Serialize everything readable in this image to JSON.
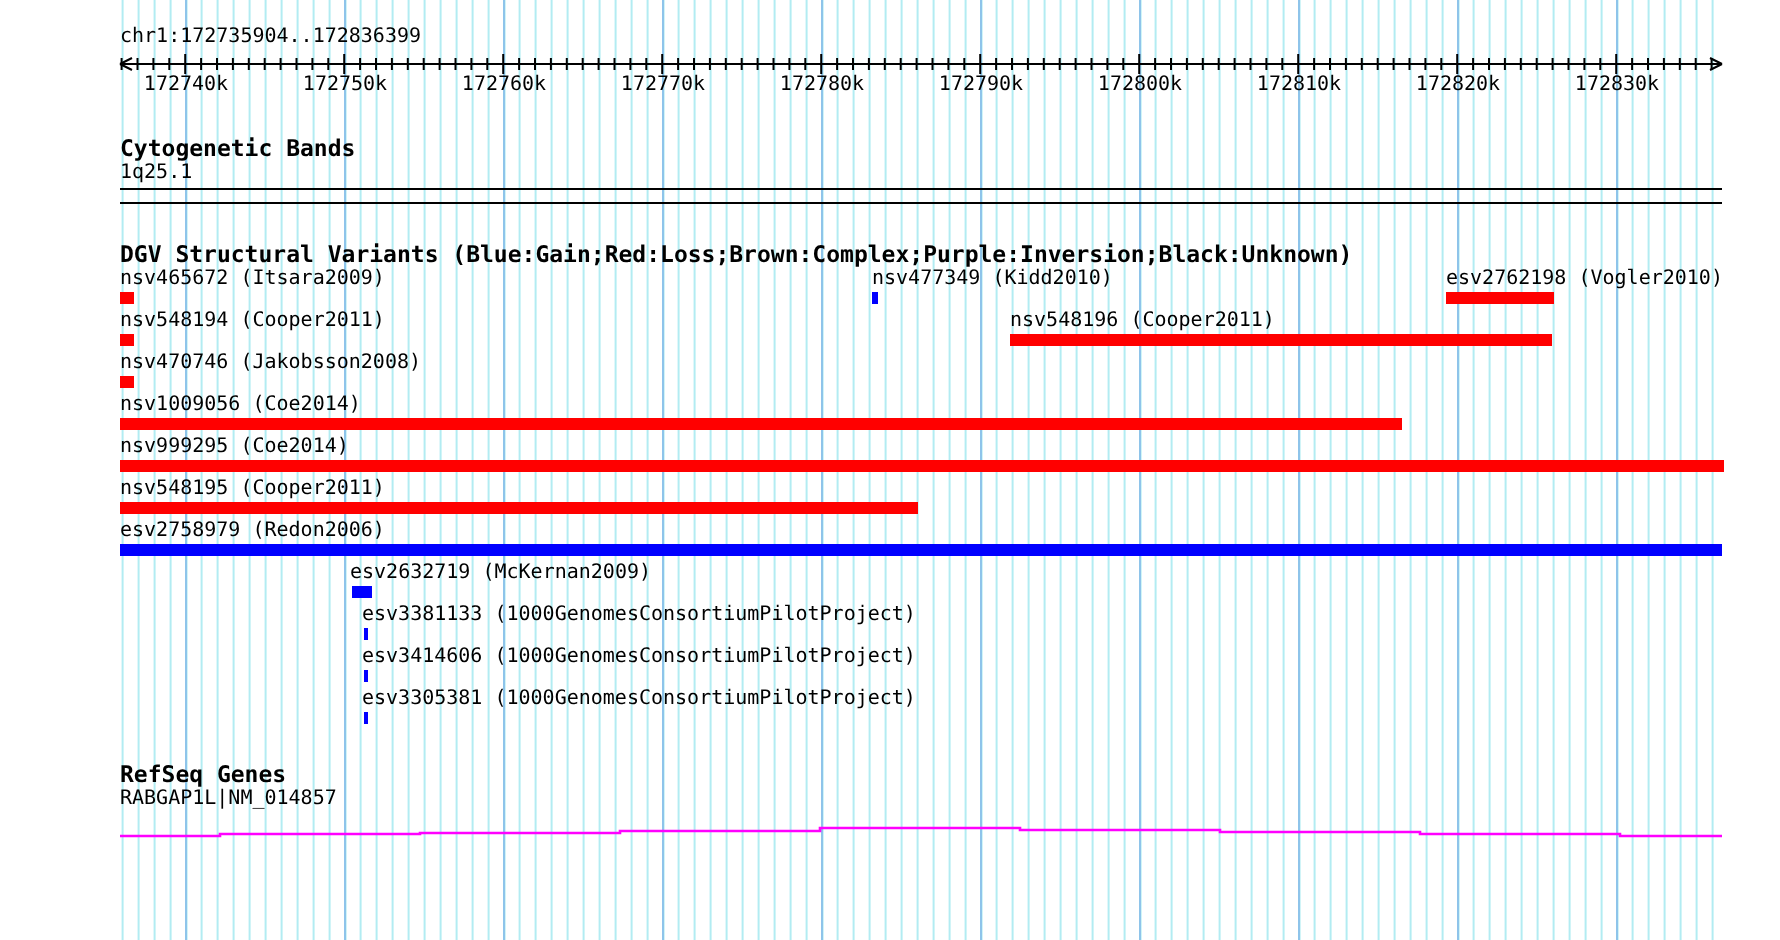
{
  "ruler": {
    "location": "chr1:172735904..172836399",
    "tick_labels": [
      "172740k",
      "172750k",
      "172760k",
      "172770k",
      "172780k",
      "172790k",
      "172800k",
      "172810k",
      "172820k",
      "172830k"
    ]
  },
  "tracks": [
    {
      "kind": "bands",
      "title": "Cytogenetic Bands",
      "label": "1q25.1"
    },
    {
      "kind": "variants",
      "title": "DGV Structural Variants (Blue:Gain;Red:Loss;Brown:Complex;Purple:Inversion;Black:Unknown)",
      "rows": [
        {
          "features": [
            {
              "label": "nsv465672 (Itsara2009)",
              "color": "#ff0000"
            },
            {
              "label": "nsv477349 (Kidd2010)",
              "color": "#0000ff"
            },
            {
              "label": "esv2762198 (Vogler2010)",
              "color": "#ff0000"
            }
          ]
        },
        {
          "features": [
            {
              "label": "nsv548194 (Cooper2011)",
              "color": "#ff0000"
            },
            {
              "label": "nsv548196 (Cooper2011)",
              "color": "#ff0000"
            }
          ]
        },
        {
          "features": [
            {
              "label": "nsv470746 (Jakobsson2008)",
              "color": "#ff0000"
            }
          ]
        },
        {
          "features": [
            {
              "label": "nsv1009056 (Coe2014)",
              "color": "#ff0000"
            }
          ]
        },
        {
          "features": [
            {
              "label": "nsv999295 (Coe2014)",
              "color": "#ff0000"
            }
          ]
        },
        {
          "features": [
            {
              "label": "nsv548195 (Cooper2011)",
              "color": "#ff0000"
            }
          ]
        },
        {
          "features": [
            {
              "label": "esv2758979 (Redon2006)",
              "color": "#0000ff"
            }
          ]
        },
        {
          "features": [
            {
              "label": "esv2632719 (McKernan2009)",
              "color": "#0000ff"
            }
          ]
        },
        {
          "features": [
            {
              "label": "esv3381133 (1000GenomesConsortiumPilotProject)",
              "color": "#0000ff"
            }
          ]
        },
        {
          "features": [
            {
              "label": "esv3414606 (1000GenomesConsortiumPilotProject)",
              "color": "#0000ff"
            }
          ]
        },
        {
          "features": [
            {
              "label": "esv3305381 (1000GenomesConsortiumPilotProject)",
              "color": "#0000ff"
            }
          ]
        }
      ]
    },
    {
      "kind": "genes",
      "title": "RefSeq Genes",
      "label": "RABGAP1L|NM_014857"
    }
  ]
}
